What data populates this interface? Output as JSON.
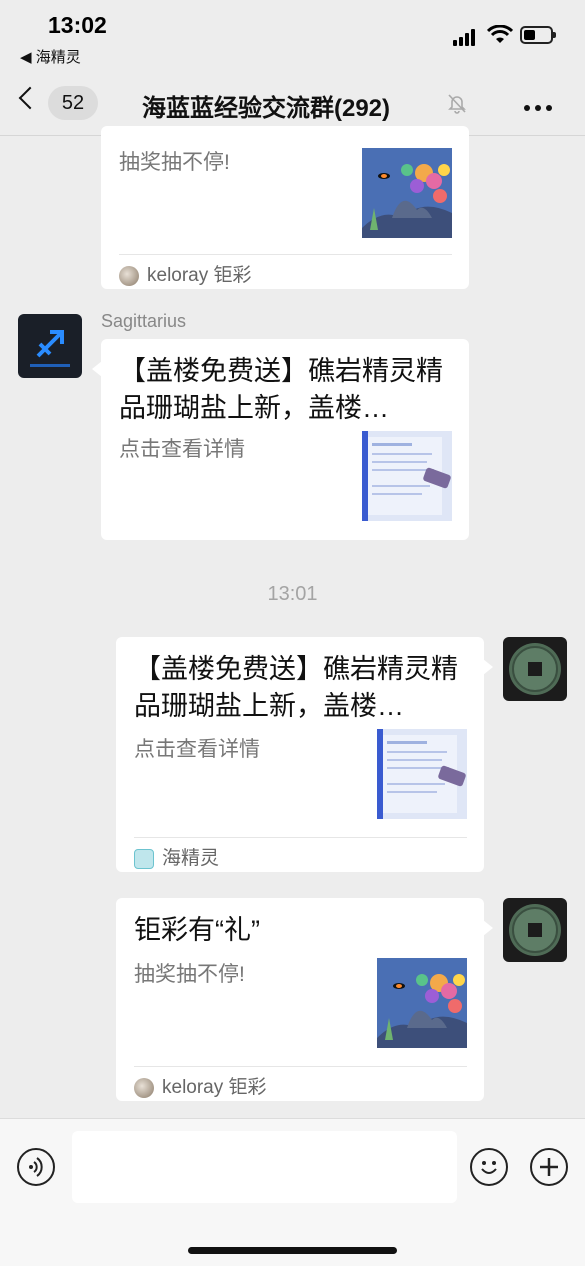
{
  "status_bar": {
    "time": "13:02",
    "back_app": "◀ 海精灵"
  },
  "nav": {
    "unread_count": "52",
    "title": "海蓝蓝经验交流群(292)"
  },
  "messages": [
    {
      "type": "card",
      "side": "left",
      "title": "",
      "desc": "抽奖抽不停!",
      "source": "keloray 钜彩",
      "thumb": "coral-reef"
    },
    {
      "type": "card",
      "side": "left",
      "sender": "Sagittarius",
      "title": "【盖楼免费送】礁岩精灵精品珊瑚盐上新，盖楼…",
      "desc": "点击查看详情",
      "thumb": "document"
    },
    {
      "type": "time",
      "text": "13:01"
    },
    {
      "type": "card",
      "side": "right",
      "title": "【盖楼免费送】礁岩精灵精品珊瑚盐上新，盖楼…",
      "desc": "点击查看详情",
      "source": "海精灵",
      "thumb": "document"
    },
    {
      "type": "card",
      "side": "right",
      "title": "钜彩有“礼”",
      "desc": "抽奖抽不停!",
      "source": "keloray 钜彩",
      "thumb": "coral-reef"
    }
  ],
  "input": {
    "placeholder": ""
  },
  "icons": {
    "voice": "voice-icon",
    "emoji": "emoji-icon",
    "plus": "plus-icon",
    "mute": "mute-bell-icon",
    "more": "more-dots-icon"
  },
  "colors": {
    "background": "#ededed",
    "bubble": "#ffffff",
    "text_gray": "#777777"
  }
}
